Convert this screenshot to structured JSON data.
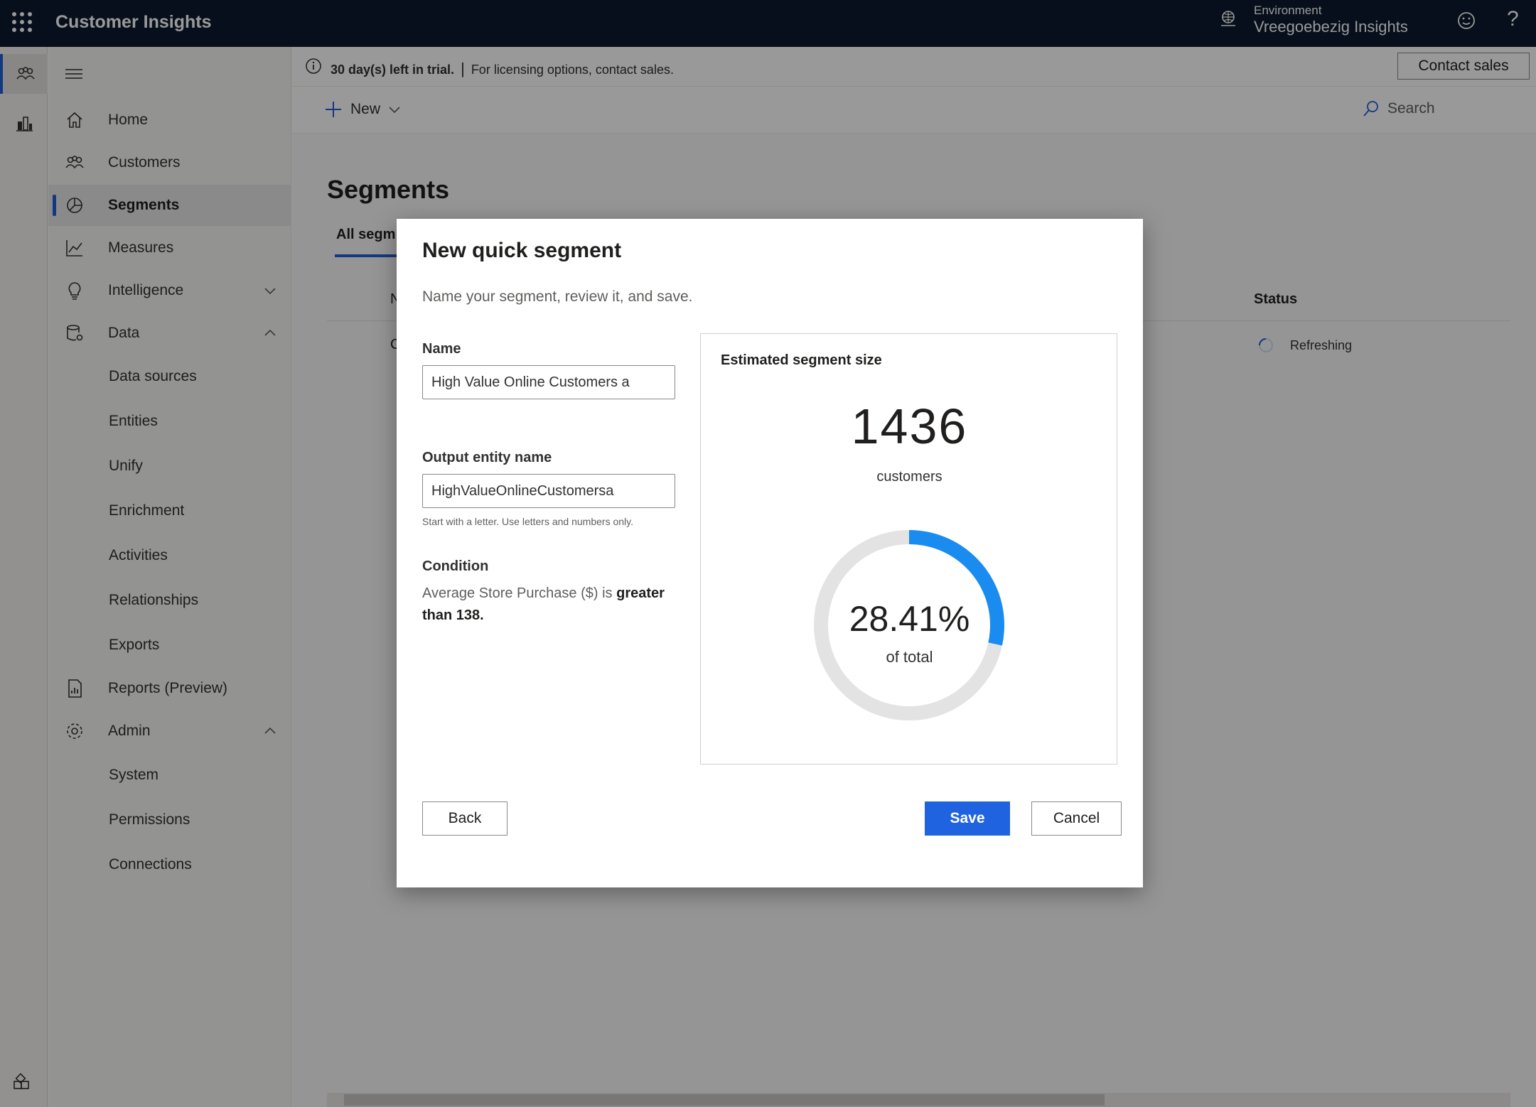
{
  "topbar": {
    "app_title": "Customer Insights",
    "env_label": "Environment",
    "env_name": "Vreegoebezig Insights"
  },
  "rail": {
    "items": [
      {
        "name": "customers-rail-icon",
        "active": true
      },
      {
        "name": "reports-rail-icon",
        "active": false
      }
    ]
  },
  "nav": {
    "items": [
      {
        "label": "Home",
        "icon": "home-icon"
      },
      {
        "label": "Customers",
        "icon": "customers-icon"
      },
      {
        "label": "Segments",
        "icon": "segments-icon",
        "active": true
      },
      {
        "label": "Measures",
        "icon": "measures-icon"
      },
      {
        "label": "Intelligence",
        "icon": "lightbulb-icon",
        "chevron": "down"
      },
      {
        "label": "Data",
        "icon": "database-icon",
        "chevron": "up"
      },
      {
        "label": "Reports (Preview)",
        "icon": "report-icon"
      },
      {
        "label": "Admin",
        "icon": "gear-icon",
        "chevron": "up"
      }
    ],
    "data_sub": [
      "Data sources",
      "Entities",
      "Unify",
      "Enrichment",
      "Activities",
      "Relationships",
      "Exports"
    ],
    "admin_sub": [
      "System",
      "Permissions",
      "Connections"
    ]
  },
  "trial": {
    "days": "30 day(s) left in trial.",
    "separator": "|",
    "info": "For licensing options, contact sales.",
    "contact_label": "Contact sales"
  },
  "commandbar": {
    "new_label": "New",
    "search_label": "Search"
  },
  "page": {
    "title": "Segments",
    "tab_all": "All segm",
    "col_n": "N",
    "col_status": "Status",
    "row_c": "C",
    "row_status": "Refreshing"
  },
  "dialog": {
    "title": "New quick segment",
    "subtitle": "Name your segment, review it, and save.",
    "name_label": "Name",
    "name_value": "High Value Online Customers a",
    "output_label": "Output entity name",
    "output_value": "HighValueOnlineCustomersa",
    "output_hint": "Start with a letter. Use letters and numbers only.",
    "condition_label": "Condition",
    "condition_pre": "Average Store Purchase ($) is ",
    "condition_bold": "greater than 138.",
    "estimate": {
      "title": "Estimated segment size",
      "count": "1436",
      "unit": "customers",
      "percent_text": "28.41%",
      "percent_value": 28.41,
      "percent_sub": "of total",
      "ring_color": "#1a8cf0",
      "track_color": "#e3e3e3"
    },
    "back_label": "Back",
    "save_label": "Save",
    "cancel_label": "Cancel"
  },
  "colors": {
    "accent": "#1f5fd6",
    "topbar": "#0b1a2e"
  }
}
